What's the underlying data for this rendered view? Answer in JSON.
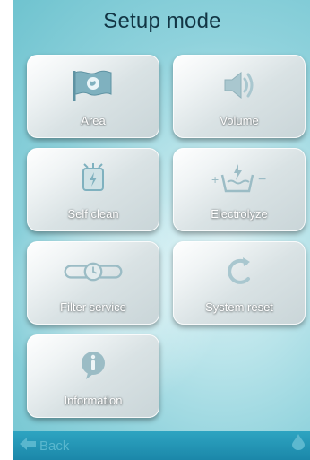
{
  "header": {
    "title": "Setup mode"
  },
  "tiles": [
    {
      "label": "Area",
      "icon": "globe-flag-icon"
    },
    {
      "label": "Volume",
      "icon": "speaker-icon"
    },
    {
      "label": "Self clean",
      "icon": "self-clean-icon"
    },
    {
      "label": "Electrolyze",
      "icon": "electrolyze-icon"
    },
    {
      "label": "Filter service",
      "icon": "filter-timer-icon"
    },
    {
      "label": "System reset",
      "icon": "reset-icon"
    },
    {
      "label": "Information",
      "icon": "info-icon"
    }
  ],
  "footer": {
    "back_label": "Back",
    "back_icon": "back-arrow-icon",
    "right_icon": "water-drop-icon"
  },
  "colors": {
    "background": "#8fd2dc",
    "title": "#123544",
    "footer": "#1b87a9"
  }
}
